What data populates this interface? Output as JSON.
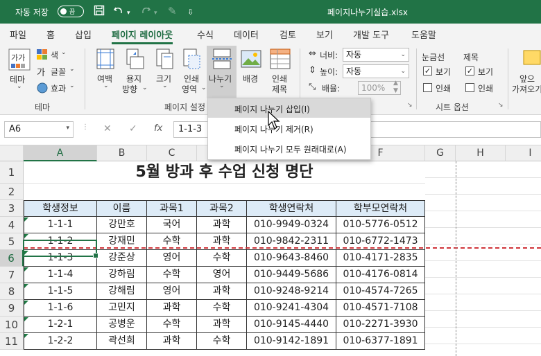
{
  "titlebar": {
    "autosave_label": "자동 저장",
    "autosave_state": "끔",
    "filename": "페이지나누기실습.xlsx",
    "save_icon": "save-icon",
    "undo_icon": "undo-icon",
    "redo_icon": "redo-icon"
  },
  "menu": [
    "파일",
    "홈",
    "삽입",
    "페이지 레이아웃",
    "수식",
    "데이터",
    "검토",
    "보기",
    "개발 도구",
    "도움말"
  ],
  "ribbon": {
    "theme": {
      "main": "테마",
      "colors": "색",
      "fonts": "글꼴",
      "effects": "효과",
      "group": "테마"
    },
    "page_setup": {
      "margins": "여백",
      "orientation_1": "용지",
      "orientation_2": "방향",
      "size": "크기",
      "print_area_1": "인쇄",
      "print_area_2": "영역",
      "breaks": "나누기",
      "background": "배경",
      "print_titles_1": "인쇄",
      "print_titles_2": "제목",
      "group": "페이지 설정"
    },
    "scale": {
      "width_label": "너비:",
      "width_value": "자동",
      "height_label": "높이:",
      "height_value": "자동",
      "scale_label": "배율:",
      "scale_value": "100%"
    },
    "sheet_options": {
      "gridlines": "눈금선",
      "headings": "제목",
      "view1": "보기",
      "print1": "인쇄",
      "view2": "보기",
      "print2": "인쇄",
      "group": "시트 옵션"
    },
    "arrange": {
      "bring_forward_1": "앞으",
      "bring_forward_2": "가져오기"
    }
  },
  "breaks_menu": [
    "페이지 나누기 삽입(I)",
    "페이지 나누기 제거(R)",
    "페이지 나누기 모두 원래대로(A)"
  ],
  "formula": {
    "name_box": "A6",
    "content": "1-1-3"
  },
  "columns": [
    "A",
    "B",
    "C",
    "D",
    "E",
    "F",
    "G",
    "H",
    "I"
  ],
  "rows": [
    "1",
    "2",
    "3",
    "4",
    "5",
    "6",
    "7",
    "8",
    "9",
    "10",
    "11"
  ],
  "sheet": {
    "title": "5월 방과 후 수업 신청 명단",
    "headers": [
      "학생정보",
      "이름",
      "과목1",
      "과목2",
      "학생연락처",
      "학부모연락처"
    ],
    "data": [
      [
        "1-1-1",
        "강만호",
        "국어",
        "과학",
        "010-9949-0324",
        "010-5776-0512"
      ],
      [
        "1-1-2",
        "강재민",
        "수학",
        "과학",
        "010-9842-2311",
        "010-6772-1473"
      ],
      [
        "1-1-3",
        "강준상",
        "영어",
        "수학",
        "010-9643-8460",
        "010-4171-2835"
      ],
      [
        "1-1-4",
        "강하림",
        "수학",
        "영어",
        "010-9449-5686",
        "010-4176-0814"
      ],
      [
        "1-1-5",
        "강해림",
        "영어",
        "과학",
        "010-9248-9214",
        "010-4574-7265"
      ],
      [
        "1-1-6",
        "고민지",
        "과학",
        "수학",
        "010-9241-4304",
        "010-4571-7108"
      ],
      [
        "1-2-1",
        "공병운",
        "수학",
        "과학",
        "010-9145-4440",
        "010-2271-3930"
      ],
      [
        "1-2-2",
        "곽선희",
        "과학",
        "수학",
        "010-9142-1891",
        "010-6377-1891"
      ]
    ]
  },
  "colors": {
    "accent": "#217346",
    "header_fill": "#ddebf7",
    "page_break": "#d0343a"
  }
}
